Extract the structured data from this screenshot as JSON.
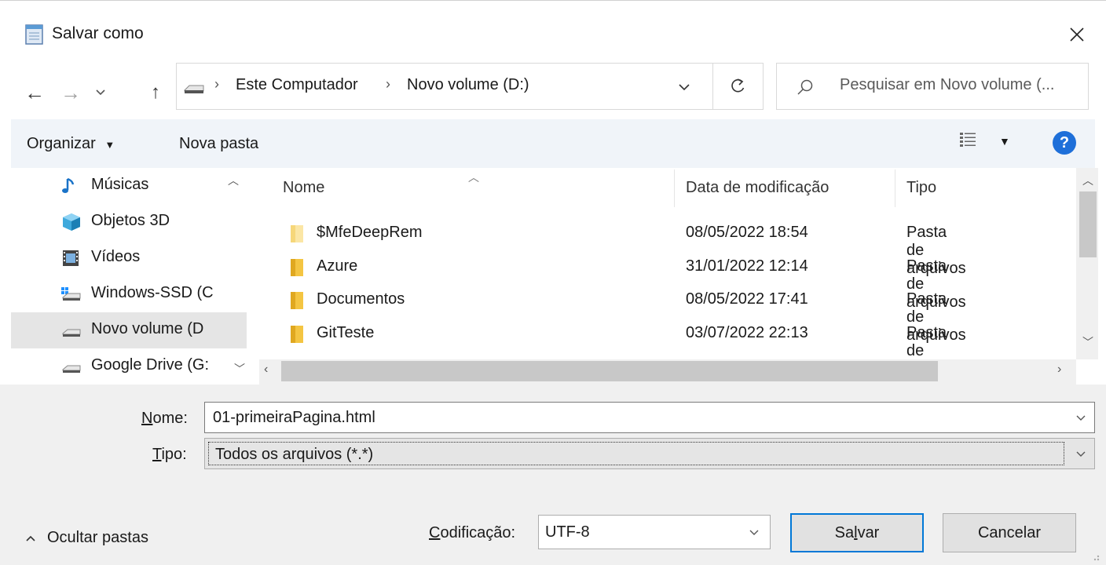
{
  "window": {
    "title": "Salvar como",
    "close_icon": "close-icon"
  },
  "address_bar": {
    "crumbs": [
      "Este Computador",
      "Novo volume (D:)"
    ]
  },
  "search": {
    "placeholder": "Pesquisar em Novo volume (..."
  },
  "toolbar": {
    "organize_label": "Organizar",
    "new_folder_label": "Nova pasta",
    "help_label": "?"
  },
  "nav_pane": {
    "items": [
      {
        "label": "Músicas",
        "icon": "music-icon"
      },
      {
        "label": "Objetos 3D",
        "icon": "3d-objects-icon"
      },
      {
        "label": "Vídeos",
        "icon": "videos-icon"
      },
      {
        "label": "Windows-SSD (C",
        "icon": "drive-c-icon"
      },
      {
        "label": "Novo volume (D",
        "icon": "drive-icon",
        "selected": true
      },
      {
        "label": "Google Drive (G:",
        "icon": "drive-icon"
      }
    ]
  },
  "file_list": {
    "columns": [
      "Nome",
      "Data de modificação",
      "Tipo"
    ],
    "rows": [
      {
        "name": "$MfeDeepRem",
        "date": "08/05/2022 18:54",
        "type": "Pasta de arquivos"
      },
      {
        "name": "Azure",
        "date": "31/01/2022 12:14",
        "type": "Pasta de arquivos"
      },
      {
        "name": "Documentos",
        "date": "08/05/2022 17:41",
        "type": "Pasta de arquivos"
      },
      {
        "name": "GitTeste",
        "date": "03/07/2022 22:13",
        "type": "Pasta de arquivos"
      }
    ]
  },
  "form": {
    "name_label_prefix": "N",
    "name_label_rest": "ome:",
    "name_value": "01-primeiraPagina.html",
    "type_label_prefix": "T",
    "type_label_rest": "ipo:",
    "type_value": "Todos os arquivos  (*.*)",
    "encoding_label_prefix": "C",
    "encoding_label_rest": "odificação:",
    "encoding_value": "UTF-8"
  },
  "footer": {
    "hide_folders_label": "Ocultar pastas",
    "save_prefix": "Sa",
    "save_u": "l",
    "save_rest": "var",
    "cancel_label": "Cancelar"
  },
  "colors": {
    "accent": "#0078d7",
    "toolbar_bg": "#f0f4f9",
    "folder": "#f4c542",
    "help": "#1e6fd9"
  }
}
